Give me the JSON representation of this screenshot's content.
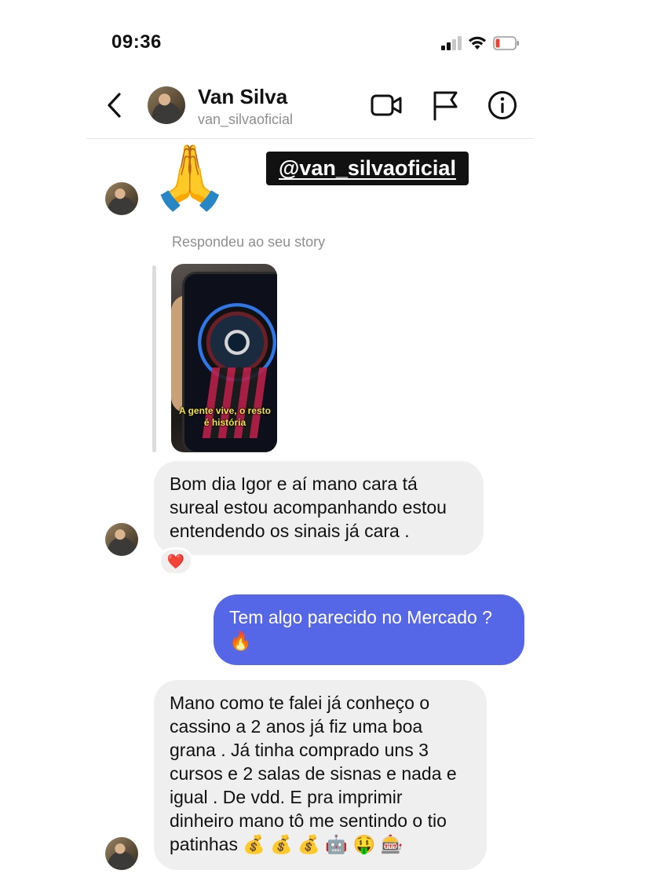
{
  "status_bar": {
    "time": "09:36"
  },
  "header": {
    "contact_name": "Van Silva",
    "contact_handle": "van_silvaoficial"
  },
  "messages": {
    "reaction_emoji": "🙏",
    "mention_sticker": "@van_silvaoficial",
    "story_reply_label": "Respondeu ao seu story",
    "story_caption": "A gente vive, o resto é história",
    "incoming_1": "Bom dia Igor e aí mano cara tá sureal estou acompanhando estou entendendo os sinais já cara .",
    "incoming_1_reaction": "❤️",
    "outgoing_1": "Tem algo parecido no Mercado ? 🔥",
    "incoming_2": "Mano como te falei já conheço o cassino a 2 anos já fiz uma boa grana . Já tinha comprado uns 3 cursos e 2 salas de sisnas e nada e igual . De vdd. E pra imprimir dinheiro mano tô me sentindo o tio patinhas 💰 💰 💰 🤖 🤑 🎰"
  },
  "colors": {
    "outgoing_bubble": "#5567e6",
    "incoming_bubble": "#efefef",
    "battery_low": "#e5463a"
  },
  "icons": [
    "signal-icon",
    "wifi-icon",
    "battery-icon",
    "back-icon",
    "video-call-icon",
    "flag-icon",
    "info-icon"
  ]
}
